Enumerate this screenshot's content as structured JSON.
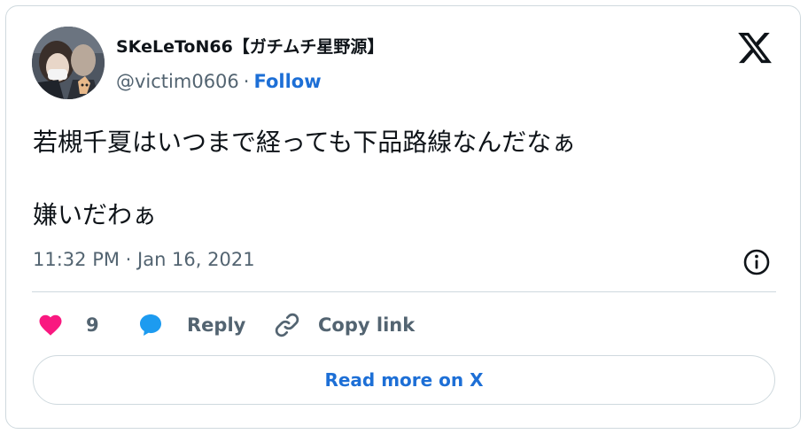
{
  "author": {
    "display_name": "SKeLeToN66【ガチムチ星野源】",
    "handle": "@victim0606",
    "separator": "·",
    "follow_label": "Follow"
  },
  "tweet": {
    "lines": [
      "若槻千夏はいつまで経っても下品路線なんだなぁ",
      "嫌いだわぁ"
    ],
    "timestamp": "11:32 PM · Jan 16, 2021"
  },
  "actions": {
    "like_count": "9",
    "reply_label": "Reply",
    "copy_label": "Copy link"
  },
  "footer": {
    "read_more_label": "Read more on X"
  },
  "icons": {
    "brand": "x-logo-icon",
    "info": "info-icon",
    "like": "heart-icon",
    "reply": "speech-bubble-icon",
    "copy": "link-icon"
  },
  "colors": {
    "link_blue": "#1d6fd6",
    "heart": "#f91880",
    "reply_blue": "#1d9bf0",
    "muted": "#536471",
    "border": "#cfd9de"
  }
}
